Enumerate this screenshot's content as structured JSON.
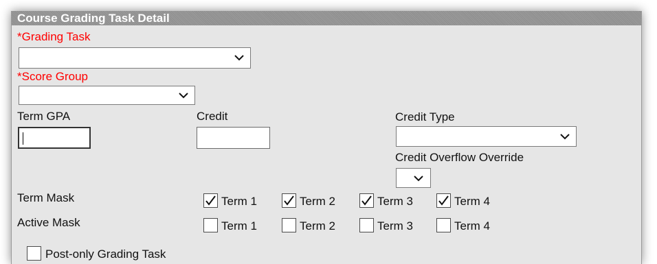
{
  "header": {
    "title": "Course Grading Task Detail"
  },
  "grading_task": {
    "label_prefix": "*",
    "label": "Grading Task",
    "value": ""
  },
  "score_group": {
    "label_prefix": "*",
    "label": "Score Group",
    "value": ""
  },
  "term_gpa": {
    "label": "Term GPA",
    "value": ""
  },
  "credit": {
    "label": "Credit",
    "value": ""
  },
  "credit_type": {
    "label": "Credit Type",
    "value": ""
  },
  "credit_overflow": {
    "label": "Credit Overflow Override",
    "value": ""
  },
  "term_mask": {
    "label": "Term Mask",
    "items": [
      {
        "label": "Term 1",
        "checked": true
      },
      {
        "label": "Term 2",
        "checked": true
      },
      {
        "label": "Term 3",
        "checked": true
      },
      {
        "label": "Term 4",
        "checked": true
      }
    ]
  },
  "active_mask": {
    "label": "Active Mask",
    "items": [
      {
        "label": "Term 1",
        "checked": false
      },
      {
        "label": "Term 2",
        "checked": false
      },
      {
        "label": "Term 3",
        "checked": false
      },
      {
        "label": "Term 4",
        "checked": false
      }
    ]
  },
  "post_only": {
    "label": "Post-only Grading Task",
    "checked": false
  },
  "colors": {
    "required": "#ff0000",
    "header_bg": "#999999",
    "panel_bg": "#e6e6e6"
  }
}
